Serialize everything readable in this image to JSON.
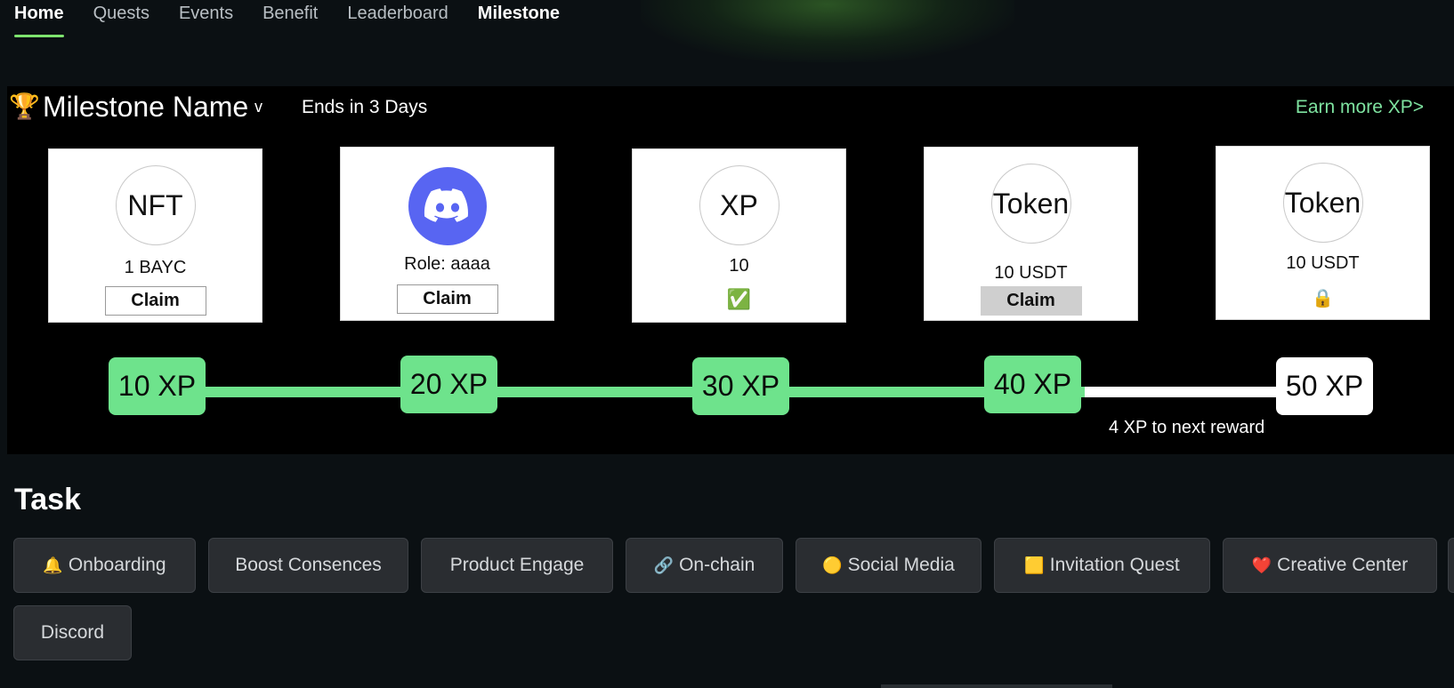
{
  "nav": {
    "items": [
      {
        "label": "Home",
        "active": true
      },
      {
        "label": "Quests"
      },
      {
        "label": "Events"
      },
      {
        "label": "Benefit"
      },
      {
        "label": "Leaderboard"
      },
      {
        "label": "Milestone"
      }
    ]
  },
  "milestone": {
    "trophy_icon": "trophy-icon",
    "title": "Milestone Name",
    "caret": "v",
    "ends": "Ends in 3 Days",
    "earn_more": "Earn more XP>",
    "rewards": [
      {
        "circle": "NFT",
        "label": "1 BAYC",
        "action": "Claim",
        "state": "claimable"
      },
      {
        "circle": "",
        "icon": "discord-icon",
        "label": "Role: aaaa",
        "action": "Claim",
        "state": "claimable"
      },
      {
        "circle": "XP",
        "label": "10",
        "status_icon": "✅",
        "state": "claimed"
      },
      {
        "circle": "Token",
        "label": "10 USDT",
        "action": "Claim",
        "state": "claimable-gray"
      },
      {
        "circle": "Token",
        "label": "10 USDT",
        "status_icon": "🔒",
        "state": "locked"
      }
    ],
    "progress": {
      "nodes": [
        "10 XP",
        "20 XP",
        "30 XP",
        "40 XP",
        "50 XP"
      ],
      "current_fraction": 0.79,
      "next_reward_text": "4 XP to next reward"
    }
  },
  "task": {
    "title": "Task",
    "tabs": [
      {
        "icon": "🔔",
        "label": "Onboarding"
      },
      {
        "icon": "",
        "label": "Boost Consences"
      },
      {
        "icon": "",
        "label": "Product Engage"
      },
      {
        "icon": "🔗",
        "label": "On-chain"
      },
      {
        "icon": "🟡",
        "label": "Social Media"
      },
      {
        "icon": "🟨",
        "label": "Invitation Quest"
      },
      {
        "icon": "❤️",
        "label": "Creative Center"
      },
      {
        "icon": "",
        "label": "Discord"
      }
    ]
  },
  "colors": {
    "background": "#0b1013",
    "accent_green": "#6ee38c",
    "earn_link": "#7ee3a0",
    "tab_bg": "#2a2d31"
  }
}
